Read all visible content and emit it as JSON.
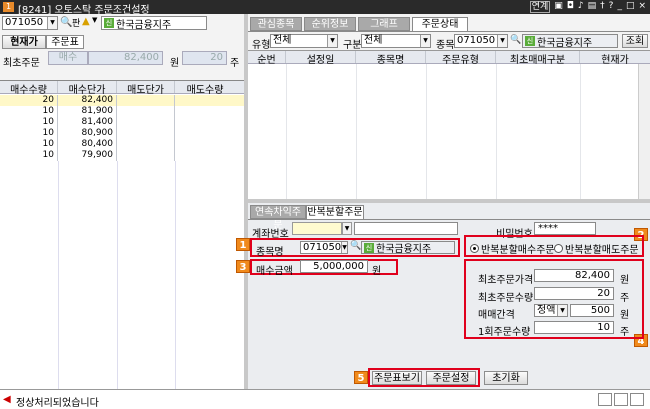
{
  "window": {
    "title": "[8241] 오토스탁 주문조건설정",
    "badge": "1",
    "tb_buttons": [
      "연계",
      "?",
      "_",
      "□",
      "×"
    ]
  },
  "left": {
    "code": "071050",
    "stock_name": "한국금융지주",
    "code_btn": "▼",
    "tabs": [
      "현재가",
      "주문표"
    ],
    "min_order_label": "최초주문",
    "min_order_mode": "매수",
    "min_order_price": "82,400",
    "unit_won": "원",
    "min_qty": "20",
    "unit_ju": "주",
    "columns": [
      "매수수량",
      "매수단가",
      "매도단가",
      "매도수량"
    ],
    "rows": [
      {
        "qty": "20",
        "price": "82,400"
      },
      {
        "qty": "10",
        "price": "81,900"
      },
      {
        "qty": "10",
        "price": "81,400"
      },
      {
        "qty": "10",
        "price": "80,900"
      },
      {
        "qty": "10",
        "price": "80,400"
      },
      {
        "qty": "10",
        "price": "79,900"
      }
    ]
  },
  "right_top": {
    "tabs": [
      "관심종목",
      "순위정보",
      "그래프",
      "주문상태"
    ],
    "filter_type_label": "유형",
    "filter_type_val": "전체",
    "filter_cat_label": "구분",
    "filter_cat_val": "전체",
    "code_label": "종목",
    "code": "071050",
    "stock_name": "한국금융지주",
    "query_btn": "조회",
    "columns": [
      "순번",
      "설정일",
      "종목명",
      "주문유형",
      "최초매매구분",
      "현재가"
    ]
  },
  "order": {
    "tabs": [
      "연속차익주문",
      "반복분할주문"
    ],
    "account_label": "계좌번호",
    "password_label": "비밀번호",
    "password_val": "****",
    "stock_label": "종목명",
    "code": "071050",
    "stock_name": "한국금융지주",
    "amount_label": "매수금액",
    "amount_val": "5,000,000",
    "unit_won": "원",
    "radio_buy": "반복분할매수주문",
    "radio_sell": "반복분할매도주문",
    "first_price_label": "최초주문가격",
    "first_price_val": "82,400",
    "first_qty_label": "최초주문수량",
    "first_qty_val": "20",
    "interval_label": "매매간격",
    "interval_mode": "정액",
    "interval_val": "500",
    "per_qty_label": "1회주문수량",
    "per_qty_val": "10",
    "unit_ju": "주",
    "btn_view": "주문표보기",
    "btn_set": "주문설정",
    "btn_reset": "초기화",
    "badges": [
      "1",
      "2",
      "3",
      "4",
      "5"
    ]
  },
  "status": {
    "message": "정상처리되었습니다"
  }
}
